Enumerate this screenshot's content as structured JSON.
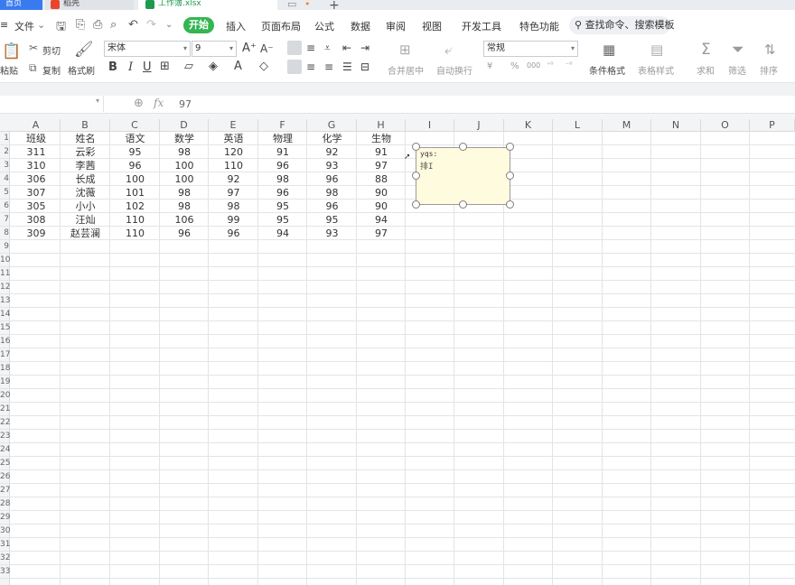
{
  "tabs": {
    "home": "首页",
    "daoke": "稻壳",
    "workbook": "工作簿.xlsx",
    "new_tab": "+"
  },
  "menubar": {
    "file": "文件",
    "active": "开始",
    "items": [
      "插入",
      "页面布局",
      "公式",
      "数据",
      "审阅",
      "视图",
      "开发工具",
      "特色功能"
    ],
    "search": "查找命令、搜索模板"
  },
  "ribbon": {
    "paste": "粘贴",
    "cut": "剪切",
    "copy": "复制",
    "format_painter": "格式刷",
    "font_name": "宋体",
    "font_size": "9",
    "merge_center": "合并居中",
    "wrap_text": "自动换行",
    "number_format": "常规",
    "currency": "¥",
    "percent": "%",
    "thousands": "000",
    "conditional_format": "条件格式",
    "table_style": "表格样式",
    "sum": "求和",
    "filter": "筛选",
    "sort": "排序"
  },
  "formula": {
    "value": "97"
  },
  "columns": [
    "A",
    "B",
    "C",
    "D",
    "E",
    "F",
    "G",
    "H",
    "I",
    "J",
    "K",
    "L",
    "M",
    "N",
    "O",
    "P"
  ],
  "rows": [
    "1",
    "2",
    "3",
    "4",
    "5",
    "6",
    "7",
    "8",
    "9",
    "10",
    "11",
    "12",
    "13",
    "14",
    "15",
    "16",
    "17",
    "18",
    "19",
    "20",
    "21",
    "22",
    "23",
    "24",
    "25",
    "26",
    "27",
    "28",
    "29",
    "30",
    "31",
    "32",
    "33"
  ],
  "table": {
    "headers": [
      "班级",
      "姓名",
      "语文",
      "数学",
      "英语",
      "物理",
      "化学",
      "生物"
    ],
    "rows": [
      [
        "311",
        "云彩",
        "95",
        "98",
        "120",
        "91",
        "92",
        "91"
      ],
      [
        "310",
        "李茜",
        "96",
        "100",
        "110",
        "96",
        "93",
        "97"
      ],
      [
        "306",
        "长成",
        "100",
        "100",
        "92",
        "98",
        "96",
        "88"
      ],
      [
        "307",
        "沈薇",
        "101",
        "98",
        "97",
        "96",
        "98",
        "90"
      ],
      [
        "305",
        "小小",
        "102",
        "98",
        "98",
        "95",
        "96",
        "90"
      ],
      [
        "308",
        "汪灿",
        "110",
        "106",
        "99",
        "95",
        "95",
        "94"
      ],
      [
        "309",
        "赵芸澜",
        "110",
        "96",
        "96",
        "94",
        "93",
        "97"
      ]
    ]
  },
  "comment": {
    "author": "yqs:",
    "text": "排I"
  },
  "colors": {
    "accent": "#33b551",
    "home_tab": "#3a7af0",
    "comment_bg": "#fffbdf"
  }
}
